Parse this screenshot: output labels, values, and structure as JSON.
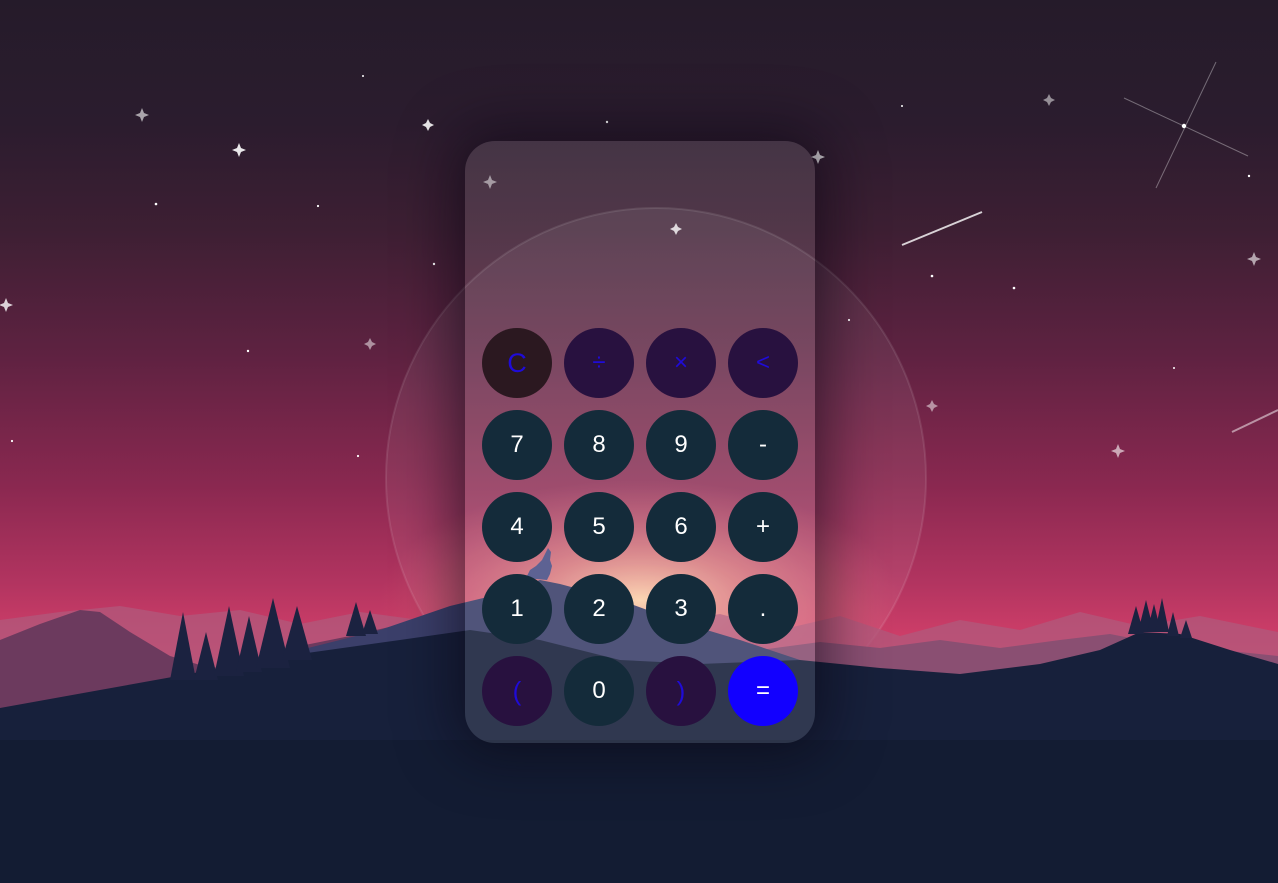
{
  "colors": {
    "sky_top": "#251b2a",
    "sky_horizon": "#d6416b",
    "ground": "#131c33",
    "number_key": "#142b3a",
    "operator_key": "#28113f",
    "clear_key": "#2b1820",
    "operator_text": "#1f0bd8",
    "equals_key": "#1200ff"
  },
  "display": {
    "value": ""
  },
  "keypad": {
    "clear": "C",
    "divide": "÷",
    "multiply": "×",
    "backspace": "<",
    "seven": "7",
    "eight": "8",
    "nine": "9",
    "minus": "-",
    "four": "4",
    "five": "5",
    "six": "6",
    "plus": "+",
    "one": "1",
    "two": "2",
    "three": "3",
    "decimal": ".",
    "open_paren": "(",
    "zero": "0",
    "close_paren": ")",
    "equals": "="
  }
}
